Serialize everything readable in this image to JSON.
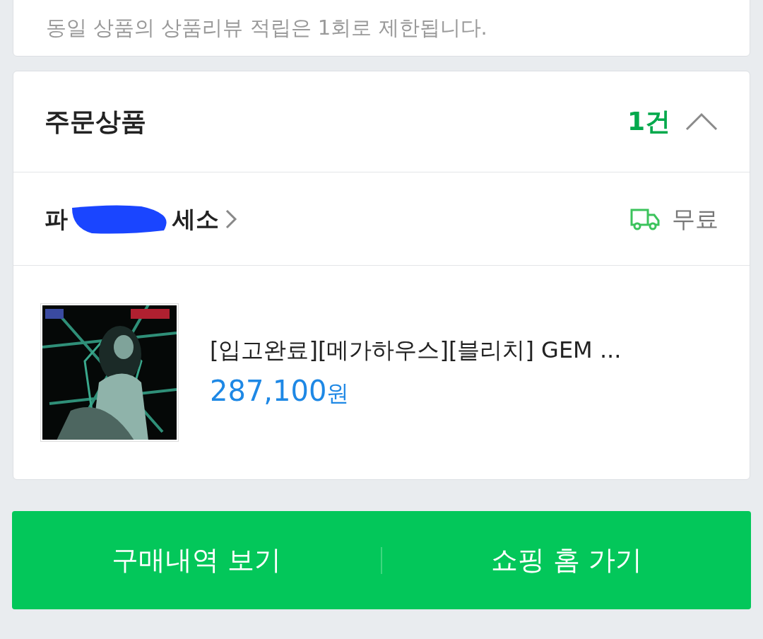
{
  "notice": "동일 상품의 상품리뷰 적립은 1회로 제한됩니다.",
  "order": {
    "title": "주문상품",
    "count": "1건",
    "expanded": true,
    "seller": {
      "name_start": "파",
      "name_end": "세소",
      "redacted": true
    },
    "shipping": "무료",
    "product": {
      "name": "[입고완료][메가하우스][블리치] GEM ...",
      "price": "287,100",
      "currency": "원"
    }
  },
  "buttons": [
    {
      "label": "구매내역 보기"
    },
    {
      "label": "쇼핑 홈 가기"
    }
  ]
}
